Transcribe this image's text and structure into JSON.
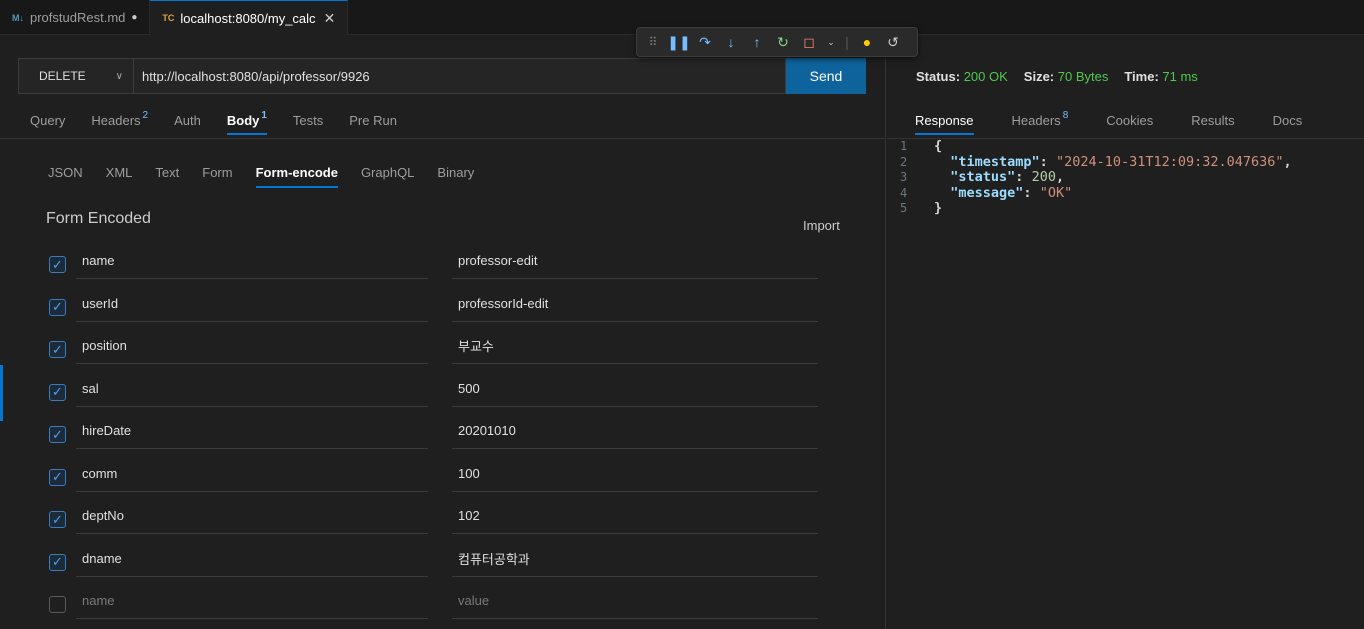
{
  "editor_tabs": [
    {
      "icon": "M↓",
      "label": "profstudRest.md",
      "modified": "●"
    },
    {
      "icon": "TC",
      "label": "localhost:8080/my_calc",
      "close": "✕"
    }
  ],
  "request": {
    "method": "DELETE",
    "url": "http://localhost:8080/api/professor/9926",
    "send_label": "Send"
  },
  "request_tabs": [
    {
      "label": "Query",
      "badge": ""
    },
    {
      "label": "Headers",
      "badge": "2"
    },
    {
      "label": "Auth",
      "badge": ""
    },
    {
      "label": "Body",
      "badge": "1"
    },
    {
      "label": "Tests",
      "badge": ""
    },
    {
      "label": "Pre Run",
      "badge": ""
    }
  ],
  "body_tabs": [
    "JSON",
    "XML",
    "Text",
    "Form",
    "Form-encode",
    "GraphQL",
    "Binary"
  ],
  "form": {
    "title": "Form Encoded",
    "import_label": "Import",
    "rows": [
      {
        "checked": true,
        "key": "name",
        "value": "professor-edit"
      },
      {
        "checked": true,
        "key": "userId",
        "value": "professorId-edit"
      },
      {
        "checked": true,
        "key": "position",
        "value": "부교수"
      },
      {
        "checked": true,
        "key": "sal",
        "value": "500"
      },
      {
        "checked": true,
        "key": "hireDate",
        "value": "20201010"
      },
      {
        "checked": true,
        "key": "comm",
        "value": "100"
      },
      {
        "checked": true,
        "key": "deptNo",
        "value": "102"
      },
      {
        "checked": true,
        "key": "dname",
        "value": "컴퓨터공학과"
      }
    ],
    "empty_row": {
      "key_placeholder": "name",
      "value_placeholder": "value"
    }
  },
  "response": {
    "status_label": "Status:",
    "status_value": "200 OK",
    "size_label": "Size:",
    "size_value": "70 Bytes",
    "time_label": "Time:",
    "time_value": "71 ms",
    "tabs": [
      {
        "label": "Response",
        "badge": ""
      },
      {
        "label": "Headers",
        "badge": "8"
      },
      {
        "label": "Cookies",
        "badge": ""
      },
      {
        "label": "Results",
        "badge": ""
      },
      {
        "label": "Docs",
        "badge": ""
      }
    ],
    "body_lines": [
      {
        "n": "1",
        "text": "{"
      },
      {
        "n": "2",
        "key": "\"timestamp\"",
        "value": "\"2024-10-31T12:09:32.047636\"",
        "type": "str",
        "trail": ","
      },
      {
        "n": "3",
        "key": "\"status\"",
        "value": "200",
        "type": "num",
        "trail": ","
      },
      {
        "n": "4",
        "key": "\"message\"",
        "value": "\"OK\"",
        "type": "str",
        "trail": ""
      },
      {
        "n": "5",
        "text": "}"
      }
    ]
  },
  "debug_toolbar": {
    "icons": [
      "grip-icon",
      "pause-icon",
      "step-over-icon",
      "step-into-icon",
      "step-out-icon",
      "restart-icon",
      "stop-icon",
      "lightbulb-icon",
      "reload-icon"
    ]
  },
  "colors": {
    "accent": "#0078d4",
    "send": "#0e639c",
    "ok": "#4ec94e",
    "badge": "#75beff"
  }
}
